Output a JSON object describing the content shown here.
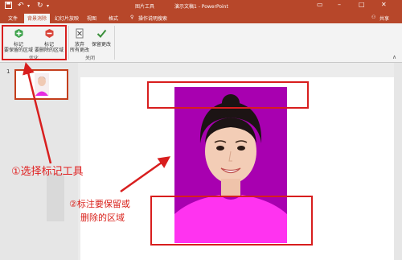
{
  "titlebar": {
    "context_tab_label": "图片工具",
    "document_title": "演示文稿1 - PowerPoint",
    "minimize": "–",
    "maximize": "□",
    "close": "✕"
  },
  "tabs": [
    {
      "label": "文件"
    },
    {
      "label": "背景消除"
    },
    {
      "label": "幻灯片放映"
    },
    {
      "label": "视图"
    },
    {
      "label": "格式"
    }
  ],
  "tell_me": "操作说明搜索",
  "share": "共享",
  "ribbon": {
    "mark_keep": {
      "line1": "标记",
      "line2": "要保留的区域"
    },
    "mark_remove": {
      "line1": "标记",
      "line2": "要删除的区域"
    },
    "discard": {
      "line1": "放弃",
      "line2": "所有更改"
    },
    "keep_changes": {
      "line1": "保留更改",
      "line2": ""
    },
    "group_optimize": "优化",
    "group_close": "关闭"
  },
  "slide_number": "1",
  "annotations": {
    "step1": "①选择标记工具",
    "step2_line1": "②标注要保留或",
    "step2_line2": "删除的区域"
  },
  "colors": {
    "accent": "#b7472a",
    "annotation_red": "#e02020",
    "photo_bg": "#a800b0"
  }
}
